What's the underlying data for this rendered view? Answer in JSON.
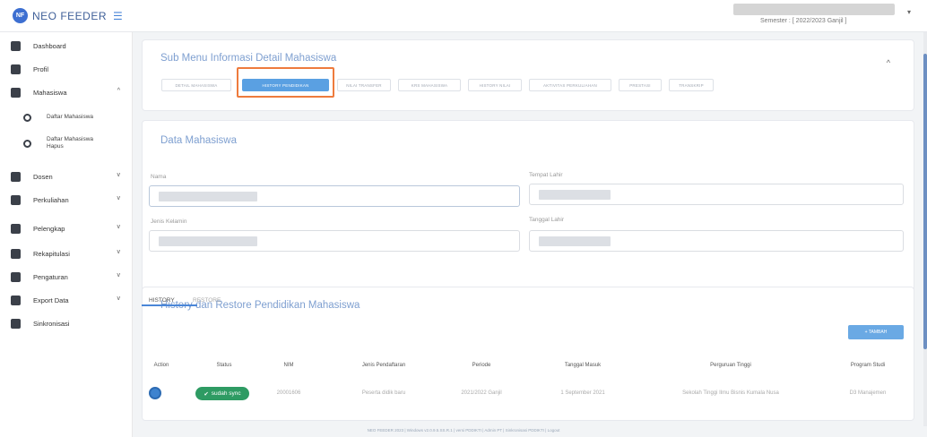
{
  "app": {
    "logo_initials": "NF",
    "name": "NEO FEEDER",
    "semester": "Semester : [ 2022/2023 Ganjil ]"
  },
  "sidebar": {
    "items": [
      {
        "label": "Dashboard",
        "icon": "dashboard-icon"
      },
      {
        "label": "Profil",
        "icon": "profile-icon"
      },
      {
        "label": "Mahasiswa",
        "icon": "graduation-cap-icon",
        "chevron": "^"
      },
      {
        "label": "Dosen",
        "icon": "teacher-icon",
        "chevron": "v"
      },
      {
        "label": "Perkuliahan",
        "icon": "book-icon",
        "chevron": "v"
      },
      {
        "label": "Pelengkap",
        "icon": "briefcase-icon",
        "chevron": "v"
      },
      {
        "label": "Rekapitulasi",
        "icon": "table-icon",
        "chevron": "v"
      },
      {
        "label": "Pengaturan",
        "icon": "gear-icon",
        "chevron": "v"
      },
      {
        "label": "Export Data",
        "icon": "export-icon",
        "chevron": "v"
      },
      {
        "label": "Sinkronisasi",
        "icon": "sync-icon"
      }
    ],
    "sub_items": [
      {
        "label": "Daftar Mahasiswa"
      },
      {
        "label": "Daftar Mahasiswa Hapus"
      }
    ]
  },
  "submenu": {
    "title": "Sub Menu Informasi Detail Mahasiswa",
    "collapse_glyph": "^",
    "tabs": [
      {
        "label": "Detail Mahasiswa"
      },
      {
        "label": "History Pendidikan"
      },
      {
        "label": "Nilai Transfer"
      },
      {
        "label": "KRS Mahasiswa"
      },
      {
        "label": "History Nilai"
      },
      {
        "label": "Aktivitas Perkuliahan"
      },
      {
        "label": "Prestasi"
      },
      {
        "label": "Transkrip"
      }
    ],
    "active_tab": "History Pendidikan"
  },
  "data_mahasiswa": {
    "title": "Data Mahasiswa",
    "fields": [
      {
        "label": "Nama"
      },
      {
        "label": "Tempat Lahir"
      },
      {
        "label": "Jenis Kelamin"
      },
      {
        "label": "Tanggal Lahir"
      }
    ]
  },
  "history": {
    "title": "History dan Restore Pendidikan Mahasiswa",
    "tabs": [
      {
        "label": "HISTORY"
      },
      {
        "label": "RESTORE"
      }
    ],
    "add_button": "+ TAMBAH",
    "columns": [
      "Action",
      "Status",
      "NIM",
      "Jenis Pendaftaran",
      "Periode",
      "Tanggal Masuk",
      "Perguruan Tinggi",
      "Program Studi"
    ],
    "rows": [
      {
        "status": "sudah sync",
        "nim": "20001606",
        "jenis_pendaftaran": "Peserta didik baru",
        "periode": "2021/2022 Ganjil",
        "tanggal_masuk": "1 September 2021",
        "perguruan_tinggi": "Sekolah Tinggi Ilmu Bisnis Kumala Nusa",
        "program_studi": "D3 Manajemen"
      }
    ]
  },
  "footer": {
    "text": "NEO FEEDER 2023 | Windows v2.0.9.5.SS.R.1 | versi PDDIKTI | Admin PT | Sinkronisasi PDDIKTI | Logout"
  },
  "colors": {
    "accent": "#4a86d8",
    "title": "#7e9fd0",
    "active_tab": "#5aa0e2",
    "highlight": "#ee7b3d",
    "sync_badge": "#2e9b63"
  }
}
